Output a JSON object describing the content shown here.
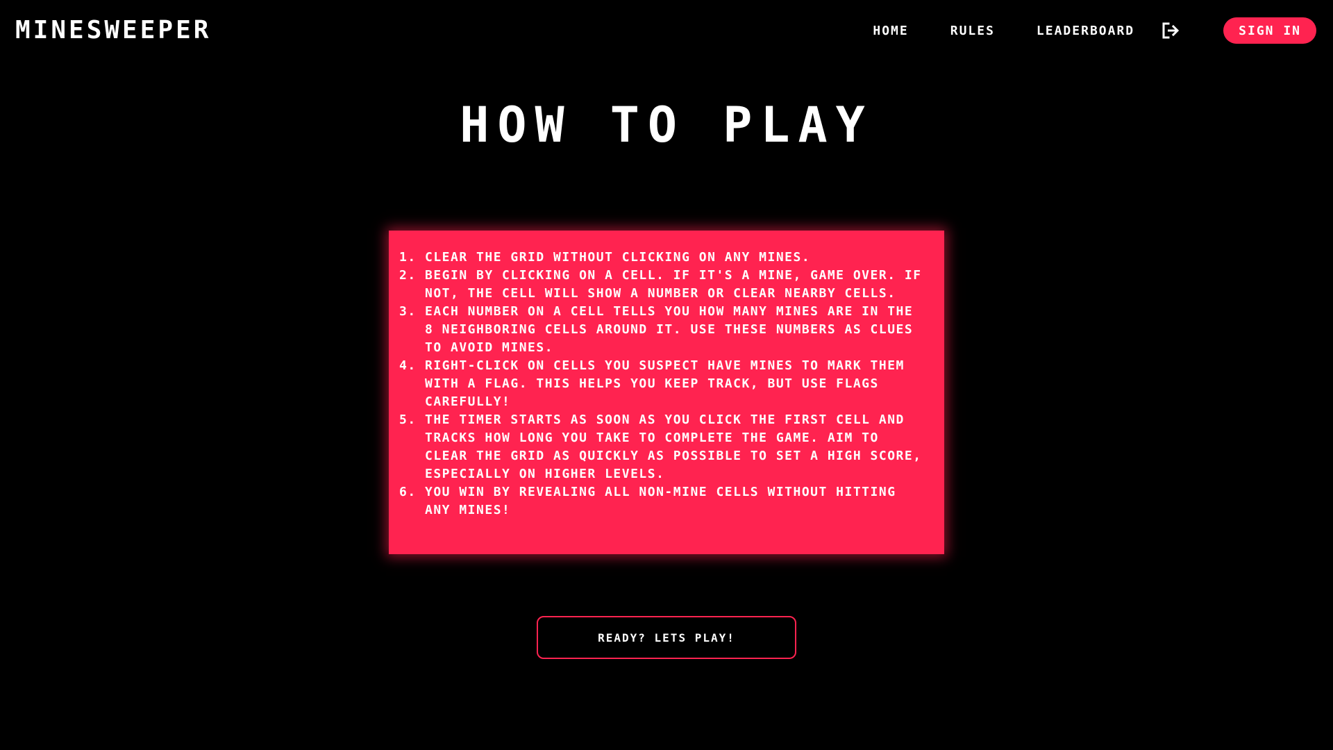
{
  "app": {
    "logo": "MINESWEEPER"
  },
  "nav": {
    "home": "HOME",
    "rules": "RULES",
    "leaderboard": "LEADERBOARD",
    "logout_icon": "logout-icon",
    "sign_in": "SIGN IN"
  },
  "main": {
    "title": "HOW TO PLAY",
    "rules": [
      "CLEAR THE GRID WITHOUT CLICKING ON ANY MINES.",
      "BEGIN BY CLICKING ON A CELL. IF IT'S A MINE, GAME OVER. IF NOT, THE CELL WILL SHOW A NUMBER OR CLEAR NEARBY CELLS.",
      "EACH NUMBER ON A CELL TELLS YOU HOW MANY MINES ARE IN THE 8 NEIGHBORING CELLS AROUND IT. USE THESE NUMBERS AS CLUES TO AVOID MINES.",
      "RIGHT-CLICK ON CELLS YOU SUSPECT HAVE MINES TO MARK THEM WITH A FLAG. THIS HELPS YOU KEEP TRACK, BUT USE FLAGS CAREFULLY!",
      "THE TIMER STARTS AS SOON AS YOU CLICK THE FIRST CELL AND TRACKS HOW LONG YOU TAKE TO COMPLETE THE GAME. AIM TO CLEAR THE GRID AS QUICKLY AS POSSIBLE TO SET A HIGH SCORE, ESPECIALLY ON HIGHER LEVELS.",
      "YOU WIN BY REVEALING ALL NON-MINE CELLS WITHOUT HITTING ANY MINES!"
    ],
    "play_button": "READY? LETS PLAY!"
  },
  "colors": {
    "background": "#000000",
    "accent": "#ff2350",
    "text": "#ffffff"
  }
}
